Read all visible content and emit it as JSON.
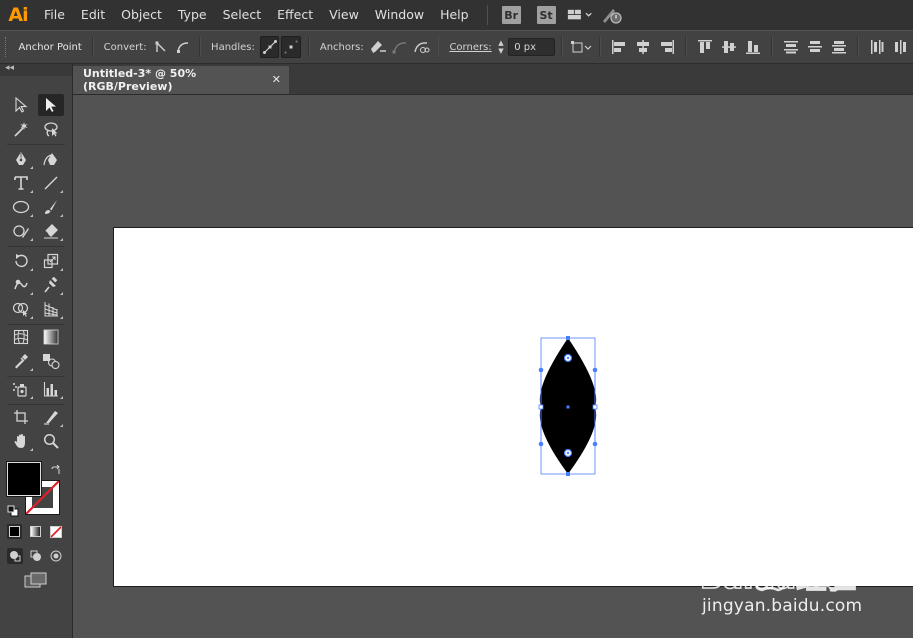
{
  "app": {
    "logo_text": "Ai",
    "menu": [
      "File",
      "Edit",
      "Object",
      "Type",
      "Select",
      "Effect",
      "View",
      "Window",
      "Help"
    ],
    "bridge_badge": "Br",
    "stock_badge": "St",
    "workspace_icon": "workspace-switcher-icon",
    "sync_icon": "gpu-sync-icon"
  },
  "control_bar": {
    "title": "Anchor Point",
    "convert_label": "Convert:",
    "handles_label": "Handles:",
    "anchors_label": "Anchors:",
    "corners_label": "Corners:",
    "corners_value": "0 px"
  },
  "document": {
    "tab_title": "Untitled-3* @ 50% (RGB/Preview)",
    "close_glyph": "✕"
  },
  "tools": {
    "fill_color": "#000000",
    "stroke_color": "#ffffff",
    "collapse_glyph": "◂◂"
  },
  "colors": {
    "accent": "#ff9a00",
    "selection": "#4a7fff",
    "shape_fill": "#000000"
  },
  "watermark": {
    "brand": "Baidu经验",
    "url": "jingyan.baidu.com"
  }
}
